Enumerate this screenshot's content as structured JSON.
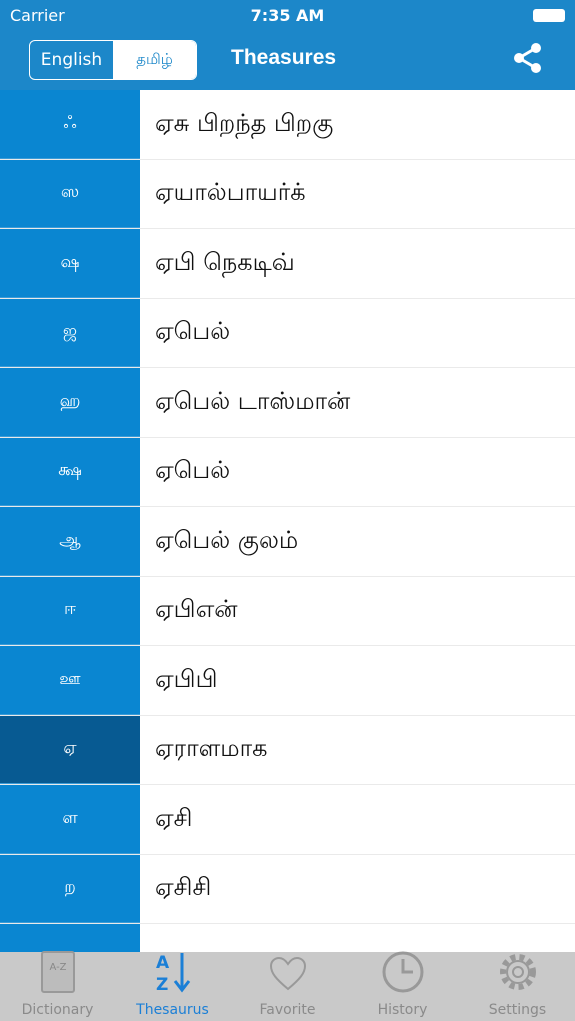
{
  "status": {
    "carrier": "Carrier",
    "time": "7:35 AM"
  },
  "header": {
    "lang_english": "English",
    "lang_tamil": "தமிழ்",
    "title": "Theasures"
  },
  "rows": [
    {
      "index": "ஃ",
      "word": "ஏசு பிறந்த பிறகு"
    },
    {
      "index": "ஸ",
      "word": "ஏயால்பாயர்க்"
    },
    {
      "index": "ஷ",
      "word": "ஏபி நெகடிவ்"
    },
    {
      "index": "ஜ",
      "word": "ஏபெல்"
    },
    {
      "index": "ஹ",
      "word": "ஏபெல் டாஸ்மான்"
    },
    {
      "index": "க்ஷ",
      "word": "ஏபெல்"
    },
    {
      "index": "ஆ",
      "word": "ஏபெல் குலம்"
    },
    {
      "index": "ஈ",
      "word": "ஏபிஎன்"
    },
    {
      "index": "ஊ",
      "word": "ஏபிபி"
    },
    {
      "index": "ஏ",
      "word": "ஏராளமாக",
      "selected": true
    },
    {
      "index": "ள",
      "word": "ஏசி"
    },
    {
      "index": "ற",
      "word": "ஏசிசி"
    },
    {
      "index": "",
      "word": ""
    }
  ],
  "tabs": [
    {
      "label": "Dictionary",
      "icon": "book-icon"
    },
    {
      "label": "Thesaurus",
      "icon": "az-sort-icon",
      "active": true
    },
    {
      "label": "Favorite",
      "icon": "heart-icon"
    },
    {
      "label": "History",
      "icon": "clock-icon"
    },
    {
      "label": "Settings",
      "icon": "gear-icon"
    }
  ],
  "colors": {
    "header": "#1c87c9",
    "index": "#0a86d1",
    "index_selected": "#075a92",
    "tab_active": "#1b7fd6"
  }
}
